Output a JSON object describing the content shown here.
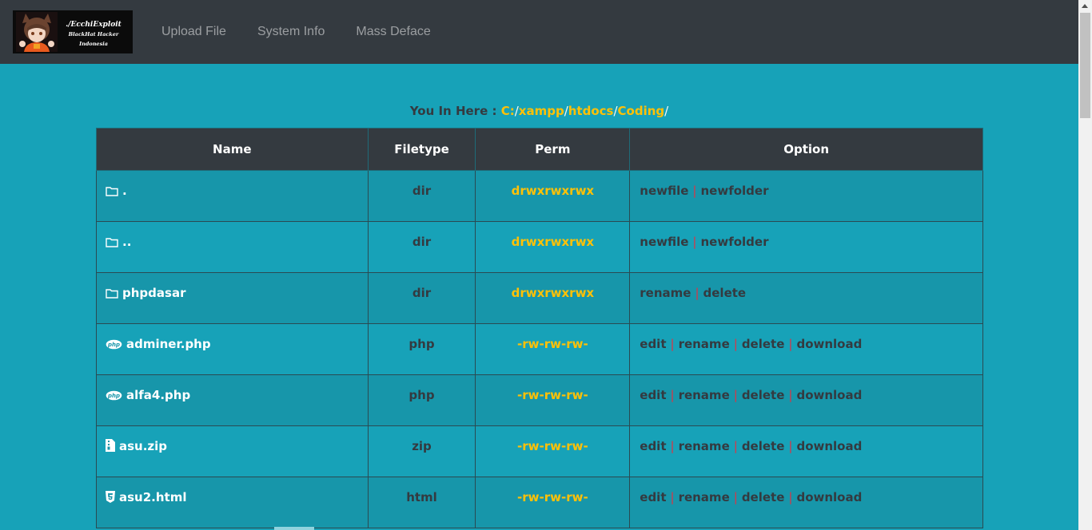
{
  "navbar": {
    "logo": {
      "line1": "./EcchiExploit",
      "line2": "BlackHat Hacker Indonesia"
    },
    "links": [
      "Upload File",
      "System Info",
      "Mass Deface"
    ]
  },
  "path": {
    "prefix": "You In Here : ",
    "segments": [
      "C:",
      "xampp",
      "htdocs",
      "Coding"
    ],
    "separator": "/"
  },
  "table": {
    "headers": [
      "Name",
      "Filetype",
      "Perm",
      "Option"
    ],
    "rows": [
      {
        "icon": "folder-icon",
        "name": ".",
        "type": "dir",
        "perm": "drwxrwxrwx",
        "options": [
          "newfile",
          "newfolder"
        ]
      },
      {
        "icon": "folder-icon",
        "name": "..",
        "type": "dir",
        "perm": "drwxrwxrwx",
        "options": [
          "newfile",
          "newfolder"
        ]
      },
      {
        "icon": "folder-icon",
        "name": "phpdasar",
        "type": "dir",
        "perm": "drwxrwxrwx",
        "options": [
          "rename",
          "delete"
        ]
      },
      {
        "icon": "php-icon",
        "name": "adminer.php",
        "type": "php",
        "perm": "-rw-rw-rw-",
        "options": [
          "edit",
          "rename",
          "delete",
          "download"
        ]
      },
      {
        "icon": "php-icon",
        "name": "alfa4.php",
        "type": "php",
        "perm": "-rw-rw-rw-",
        "options": [
          "edit",
          "rename",
          "delete",
          "download"
        ]
      },
      {
        "icon": "zip-file-icon",
        "name": "asu.zip",
        "type": "zip",
        "perm": "-rw-rw-rw-",
        "options": [
          "edit",
          "rename",
          "delete",
          "download"
        ]
      },
      {
        "icon": "html5-icon",
        "name": "asu2.html",
        "type": "html",
        "perm": "-rw-rw-rw-",
        "options": [
          "edit",
          "rename",
          "delete",
          "download"
        ]
      }
    ]
  },
  "colors": {
    "background": "#17a2b8",
    "navbar": "#343a40",
    "accent": "#ffc107",
    "separator": "#dc3545"
  }
}
